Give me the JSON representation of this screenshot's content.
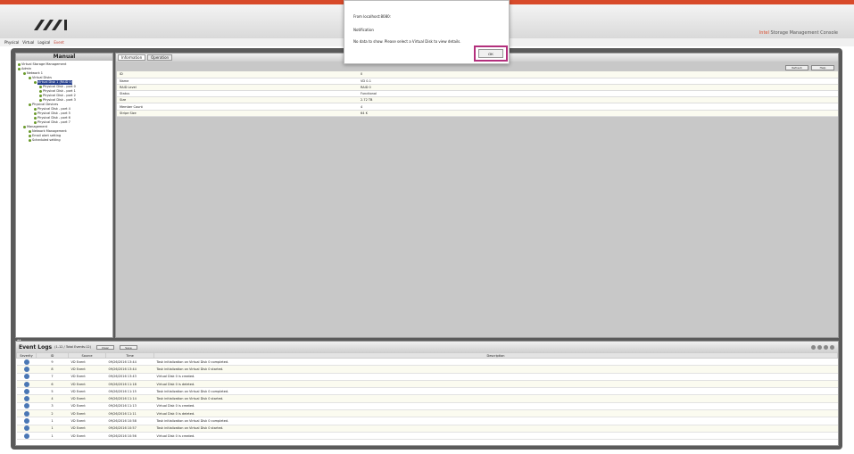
{
  "app": {
    "brand_prefix": "Intel",
    "brand_name": "Storage Management Console",
    "accent_color": "#d84a2a"
  },
  "menu": {
    "items": [
      "Physical",
      "Virtual",
      "Logical",
      "Event"
    ],
    "selected": "Event"
  },
  "sidebar": {
    "title": "Manual",
    "tree": [
      {
        "label": "Virtual Storage Management",
        "level": 0
      },
      {
        "label": "Admin",
        "level": 0
      },
      {
        "label": "Network 1",
        "level": 1
      },
      {
        "label": "Virtual Disks",
        "level": 2
      },
      {
        "label": "Virtual Disk 1 (RAID 0)",
        "level": 3,
        "selected": true
      },
      {
        "label": "Physical Disk - port 0",
        "level": 4
      },
      {
        "label": "Physical Disk - port 1",
        "level": 4
      },
      {
        "label": "Physical Disk - port 2",
        "level": 4
      },
      {
        "label": "Physical Disk - port 3",
        "level": 4
      },
      {
        "label": "Physical Devices",
        "level": 2
      },
      {
        "label": "Physical Disk - port 4",
        "level": 3
      },
      {
        "label": "Physical Disk - port 5",
        "level": 3
      },
      {
        "label": "Physical Disk - port 6",
        "level": 3
      },
      {
        "label": "Physical Disk - port 7",
        "level": 3
      },
      {
        "label": "Management",
        "level": 1
      },
      {
        "label": "Network Management",
        "level": 2
      },
      {
        "label": "Email alert setting",
        "level": 2
      },
      {
        "label": "Scheduled setting",
        "level": 2
      }
    ]
  },
  "main": {
    "tabs": [
      "Information",
      "Operation"
    ],
    "active_tab": "Information",
    "buttons": [
      "Refresh",
      "Help"
    ],
    "properties": [
      {
        "key": "ID",
        "value": "0"
      },
      {
        "key": "Name",
        "value": "VD 0-1"
      },
      {
        "key": "RAID Level",
        "value": "RAID 0"
      },
      {
        "key": "Status",
        "value": "Functional"
      },
      {
        "key": "Size",
        "value": "2.72 TB"
      },
      {
        "key": "Member Count",
        "value": "4"
      },
      {
        "key": "Stripe Size",
        "value": "64 K"
      }
    ]
  },
  "events": {
    "title": "Event Logs",
    "subtitle": "(1-12 / Total Events:12)",
    "buttons": [
      "Clear",
      "Save"
    ],
    "columns": [
      "Severity",
      "ID",
      "Source",
      "Time",
      "Description"
    ],
    "rows": [
      {
        "id": "9",
        "source": "VD Event",
        "time": "09/26/2016 13:44",
        "desc": "Task initialization on Virtual Disk 0 completed."
      },
      {
        "id": "8",
        "source": "VD Event",
        "time": "09/26/2016 13:44",
        "desc": "Task initialization on Virtual Disk 0 started."
      },
      {
        "id": "7",
        "source": "VD Event",
        "time": "09/26/2016 13:43",
        "desc": "Virtual Disk 0 is created."
      },
      {
        "id": "6",
        "source": "VD Event",
        "time": "09/26/2016 11:18",
        "desc": "Virtual Disk 0 is deleted."
      },
      {
        "id": "5",
        "source": "VD Event",
        "time": "09/26/2016 11:15",
        "desc": "Task initialization on Virtual Disk 0 completed."
      },
      {
        "id": "4",
        "source": "VD Event",
        "time": "09/26/2016 11:14",
        "desc": "Task initialization on Virtual Disk 0 started."
      },
      {
        "id": "3",
        "source": "VD Event",
        "time": "09/26/2016 11:13",
        "desc": "Virtual Disk 0 is created."
      },
      {
        "id": "2",
        "source": "VD Event",
        "time": "09/26/2016 11:11",
        "desc": "Virtual Disk 0 is deleted."
      },
      {
        "id": "1",
        "source": "VD Event",
        "time": "09/26/2016 10:58",
        "desc": "Task initialization on Virtual Disk 0 completed."
      },
      {
        "id": "1",
        "source": "VD Event",
        "time": "09/26/2016 10:57",
        "desc": "Task initialization on Virtual Disk 0 started."
      },
      {
        "id": "1",
        "source": "VD Event",
        "time": "09/26/2016 10:56",
        "desc": "Virtual Disk 0 is created."
      }
    ]
  },
  "dialog": {
    "from": "From localhost:8080:",
    "title": "Notification",
    "message": "No data to show. Please select a Virtual Disk to view details.",
    "ok_label": "OK"
  }
}
